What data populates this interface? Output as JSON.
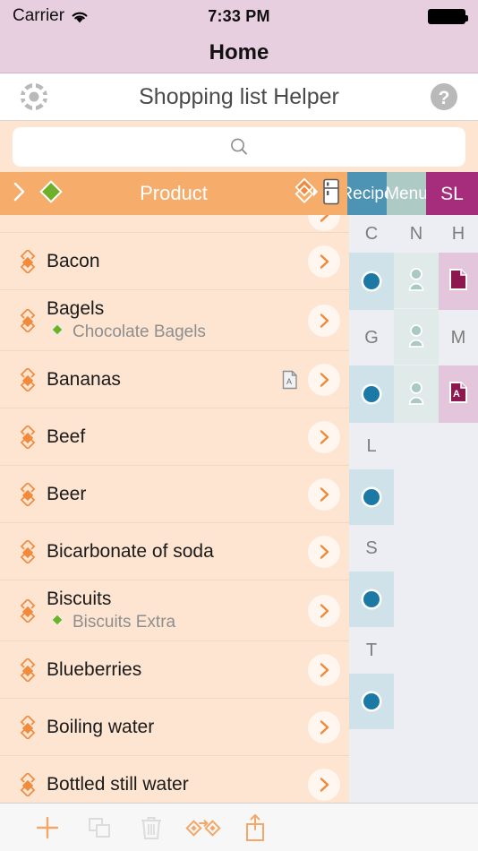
{
  "status_bar": {
    "carrier": "Carrier",
    "wifi_icon": "wifi-icon",
    "time": "7:33 PM",
    "battery_icon": "battery-full-icon"
  },
  "nav_bar": {
    "title": "Home"
  },
  "app_bar": {
    "settings_icon": "gear-icon",
    "title": "Shopping list Helper",
    "help_icon": "help-circle-icon"
  },
  "search": {
    "value": "",
    "placeholder": "",
    "icon": "search-icon"
  },
  "table_header": {
    "expand_icon": "chevron-right-icon",
    "green_diamond_icon": "green-diamond-icon",
    "product_label": "Product",
    "move_icon": "diamond-stack-icon",
    "fridge_icon": "fridge-icon",
    "columns": [
      {
        "label": "Recipe",
        "key": "recipe",
        "color": "#4d93b3"
      },
      {
        "label": "Menu",
        "key": "menu",
        "color": "#aecac5"
      },
      {
        "label": "SL",
        "key": "sl",
        "color": "#a62d7c"
      }
    ]
  },
  "products": [
    {
      "name": "Bacon",
      "sub": null,
      "note": false,
      "bullet": "layers-icon"
    },
    {
      "name": "Bagels",
      "sub": "Chocolate Bagels",
      "note": false,
      "bullet": "layers-icon"
    },
    {
      "name": "Bananas",
      "sub": null,
      "note": true,
      "bullet": "layers-icon"
    },
    {
      "name": "Beef",
      "sub": null,
      "note": false,
      "bullet": "layers-icon"
    },
    {
      "name": "Beer",
      "sub": null,
      "note": false,
      "bullet": "layers-icon"
    },
    {
      "name": "Bicarbonate of soda",
      "sub": null,
      "note": false,
      "bullet": "layers-icon"
    },
    {
      "name": "Biscuits",
      "sub": "Biscuits Extra",
      "note": false,
      "bullet": "layers-icon"
    },
    {
      "name": "Blueberries",
      "sub": null,
      "note": false,
      "bullet": "layers-icon"
    },
    {
      "name": "Boiling water",
      "sub": null,
      "note": false,
      "bullet": "layers-icon"
    },
    {
      "name": "Bottled still water",
      "sub": null,
      "note": false,
      "bullet": "layers-icon"
    }
  ],
  "matrix": {
    "recipe": {
      "labels": [
        "C",
        "G",
        "L",
        "S",
        "T"
      ],
      "cells": [
        {
          "type": "dot"
        },
        {
          "type": "empty"
        },
        {
          "type": "dot"
        },
        {
          "type": "dot"
        },
        {
          "type": "dot"
        },
        {
          "type": "dot"
        }
      ]
    },
    "menu": {
      "labels": [
        "N"
      ],
      "cells": [
        {
          "type": "person"
        },
        {
          "type": "person"
        },
        {
          "type": "person"
        }
      ]
    },
    "sl": {
      "labels": [
        "H",
        "M"
      ],
      "cells": [
        {
          "type": "doc"
        },
        {
          "type": "doc-a"
        }
      ]
    }
  },
  "toolbar": {
    "buttons": [
      {
        "name": "add-button",
        "icon": "plus-icon",
        "enabled": true
      },
      {
        "name": "copy-button",
        "icon": "copy-icon",
        "enabled": false
      },
      {
        "name": "delete-button",
        "icon": "trash-icon",
        "enabled": false
      },
      {
        "name": "move-button",
        "icon": "transfer-arrow-icon",
        "enabled": true
      },
      {
        "name": "share-button",
        "icon": "share-up-icon",
        "enabled": true
      }
    ]
  },
  "colors": {
    "status_bg": "#e7cfdf",
    "header_orange": "#f6ad6c",
    "list_bg": "#fde5d2",
    "recipe": "#4d93b3",
    "menu": "#aecac5",
    "sl": "#a62d7c",
    "matrix_bg": "#eceef3",
    "accent_orange": "#f6ad6c",
    "green_diamond": "#6fb02a"
  }
}
